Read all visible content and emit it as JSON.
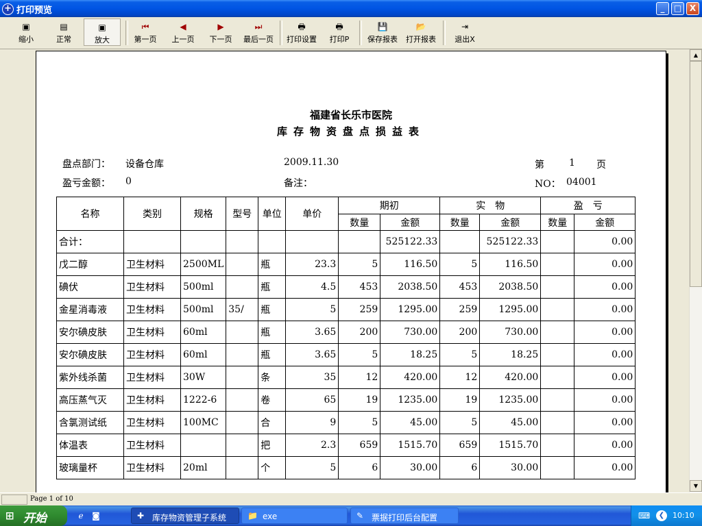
{
  "window": {
    "title": "打印预览",
    "controls": {
      "minimize": "_",
      "maximize": "□",
      "close": "X"
    }
  },
  "toolbar": {
    "buttons": [
      {
        "id": "zoom-out",
        "label": "缩小",
        "icon": "zoom-out-icon",
        "glyph": "▣"
      },
      {
        "id": "normal",
        "label": "正常",
        "icon": "page-icon",
        "glyph": "▤"
      },
      {
        "id": "zoom-in",
        "label": "放大",
        "icon": "zoom-in-icon",
        "glyph": "▣",
        "pressed": true
      },
      {
        "id": "first-page",
        "label": "第一页",
        "icon": "first-page-icon",
        "glyph": "⏮"
      },
      {
        "id": "prev-page",
        "label": "上一页",
        "icon": "prev-page-icon",
        "glyph": "◀"
      },
      {
        "id": "next-page",
        "label": "下一页",
        "icon": "next-page-icon",
        "glyph": "▶"
      },
      {
        "id": "last-page",
        "label": "最后一页",
        "icon": "last-page-icon",
        "glyph": "⏭"
      },
      {
        "id": "print-setup",
        "label": "打印设置",
        "icon": "print-setup-icon",
        "glyph": "🖶"
      },
      {
        "id": "print",
        "label": "打印P",
        "icon": "printer-icon",
        "glyph": "🖶"
      },
      {
        "id": "save-report",
        "label": "保存报表",
        "icon": "save-icon",
        "glyph": "💾"
      },
      {
        "id": "open-report",
        "label": "打开报表",
        "icon": "open-folder-icon",
        "glyph": "📂"
      },
      {
        "id": "exit",
        "label": "退出X",
        "icon": "exit-icon",
        "glyph": "⇥"
      }
    ]
  },
  "report": {
    "hospital": "福建省长乐市医院",
    "title": "库存物资盘点损益表",
    "dept_label": "盘点部门：",
    "dept": "设备仓库",
    "date": "2009.11.30",
    "page_prefix": "第",
    "page_num": "1",
    "page_suffix": "页",
    "loss_label": "盈亏金额：",
    "loss": "0",
    "note_label": "备注：",
    "no_label": "NO：",
    "no": "04001",
    "headers": {
      "name": "名称",
      "category": "类别",
      "spec": "规格",
      "model": "型号",
      "unit": "单位",
      "price": "单价",
      "opening": "期初",
      "actual": "实　物",
      "profit_loss": "盈　亏",
      "qty": "数量",
      "amount": "金额"
    },
    "rows": [
      [
        "合计：",
        "",
        "",
        "",
        "",
        "",
        "",
        "525122.33",
        "",
        "525122.33",
        "",
        "0.00"
      ],
      [
        "戊二醇",
        "卫生材料",
        "2500ML",
        "",
        "瓶",
        "23.3",
        "5",
        "116.50",
        "5",
        "116.50",
        "",
        "0.00"
      ],
      [
        "碘伏",
        "卫生材料",
        "500ml",
        "",
        "瓶",
        "4.5",
        "453",
        "2038.50",
        "453",
        "2038.50",
        "",
        "0.00"
      ],
      [
        "金星消毒液",
        "卫生材料",
        "500ml",
        "35/",
        "瓶",
        "5",
        "259",
        "1295.00",
        "259",
        "1295.00",
        "",
        "0.00"
      ],
      [
        "安尔碘皮肤",
        "卫生材料",
        "60ml",
        "",
        "瓶",
        "3.65",
        "200",
        "730.00",
        "200",
        "730.00",
        "",
        "0.00"
      ],
      [
        "安尔碘皮肤",
        "卫生材料",
        "60ml",
        "",
        "瓶",
        "3.65",
        "5",
        "18.25",
        "5",
        "18.25",
        "",
        "0.00"
      ],
      [
        "紫外线杀菌",
        "卫生材料",
        "30W",
        "",
        "条",
        "35",
        "12",
        "420.00",
        "12",
        "420.00",
        "",
        "0.00"
      ],
      [
        "高压蒸气灭",
        "卫生材料",
        "1222-6",
        "",
        "卷",
        "65",
        "19",
        "1235.00",
        "19",
        "1235.00",
        "",
        "0.00"
      ],
      [
        "含氯测试纸",
        "卫生材料",
        "100MC",
        "",
        "合",
        "9",
        "5",
        "45.00",
        "5",
        "45.00",
        "",
        "0.00"
      ],
      [
        "体温表",
        "卫生材料",
        "",
        "",
        "把",
        "2.3",
        "659",
        "1515.70",
        "659",
        "1515.70",
        "",
        "0.00"
      ],
      [
        "玻璃量杯",
        "卫生材料",
        "20ml",
        "",
        "个",
        "5",
        "6",
        "30.00",
        "6",
        "30.00",
        "",
        "0.00"
      ]
    ]
  },
  "statusbar": {
    "page_info": "Page 1 of 10"
  },
  "taskbar": {
    "start_label": "开始",
    "tasks": [
      {
        "label": "库存物资管理子系统",
        "icon": "app-plus-icon",
        "glyph": "✚",
        "active": true
      },
      {
        "label": "exe",
        "icon": "folder-icon",
        "glyph": "📁",
        "active": false
      },
      {
        "label": "票据打印后台配置",
        "icon": "config-icon",
        "glyph": "✎",
        "active": false
      }
    ],
    "clock": "10:10"
  }
}
